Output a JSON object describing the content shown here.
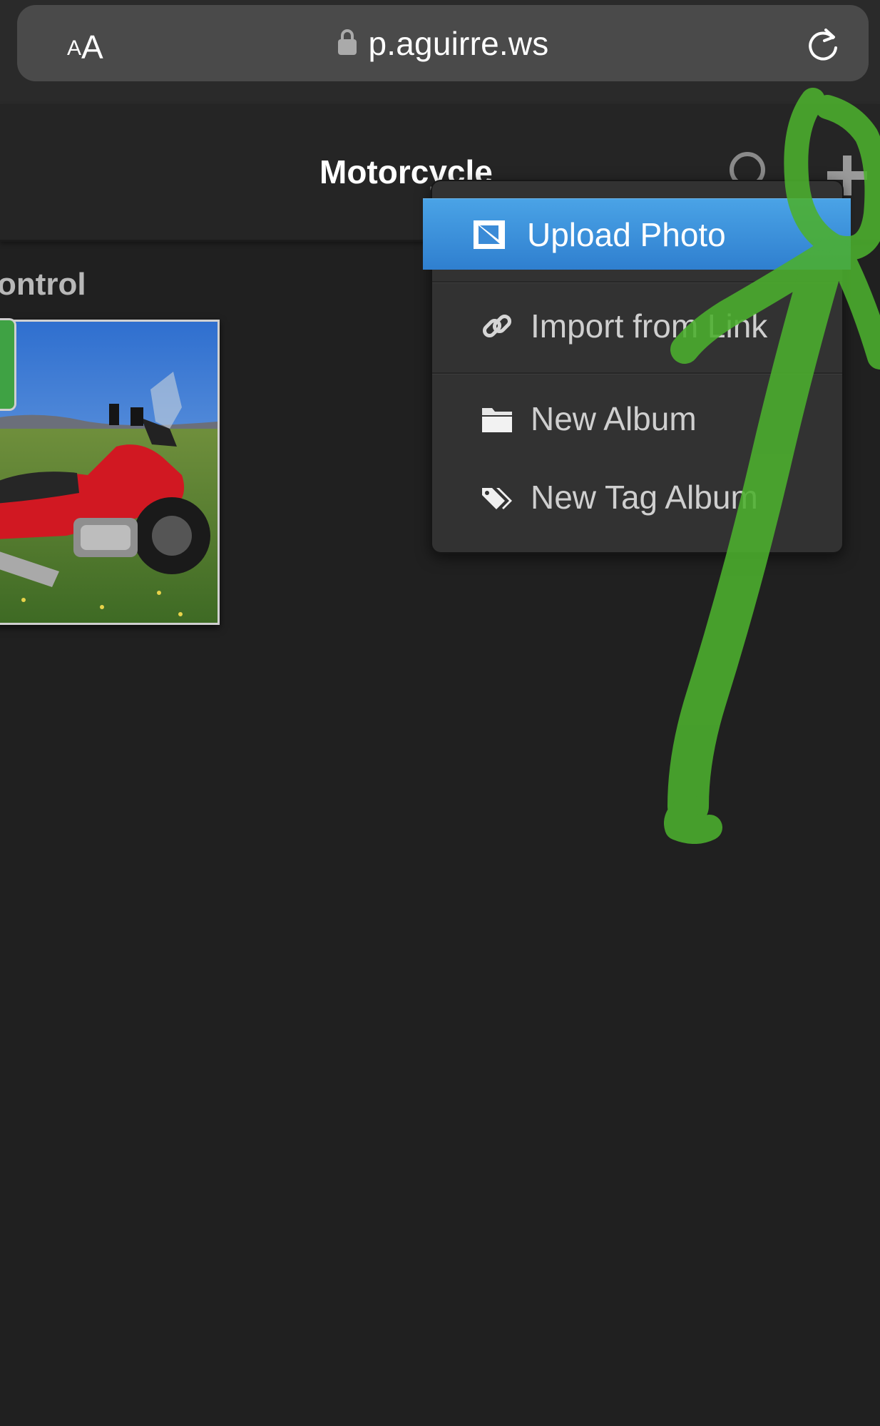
{
  "browser": {
    "text_size_small": "A",
    "text_size_large": "A",
    "url": "p.aguirre.ws"
  },
  "header": {
    "title": "Motorcycle"
  },
  "content": {
    "section_title": "ontrol"
  },
  "menu": {
    "items": [
      {
        "label": "Upload Photo",
        "icon": "image-icon",
        "active": true
      },
      {
        "label": "Import from Link",
        "icon": "link-icon"
      },
      {
        "label": "New Album",
        "icon": "folder-icon"
      },
      {
        "label": "New Tag Album",
        "icon": "tags-icon"
      }
    ]
  },
  "colors": {
    "background": "#202020",
    "menu_active": "#3a91da",
    "marker_green": "#4cb02e"
  }
}
